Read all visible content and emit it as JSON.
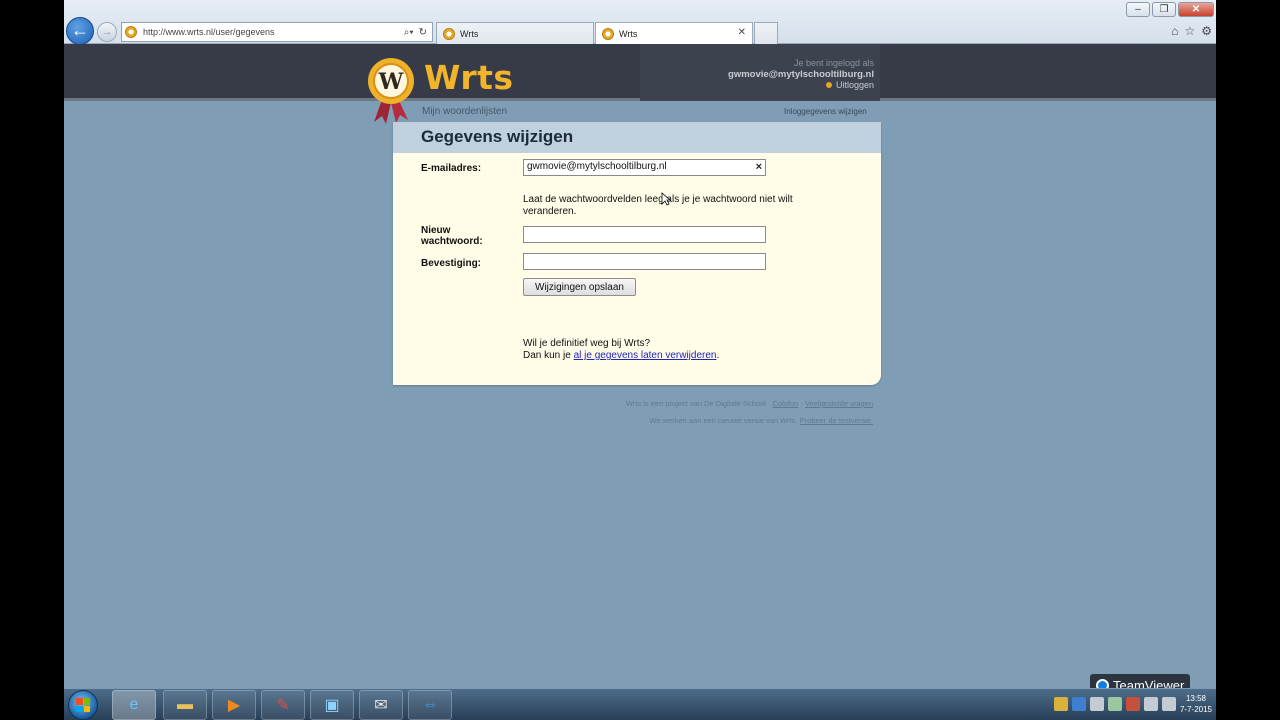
{
  "browser": {
    "url": "http://www.wrts.nl/user/gegevens",
    "tabs": [
      {
        "label": "Wrts",
        "active": false
      },
      {
        "label": "Wrts",
        "active": true
      }
    ],
    "close_label": "✕",
    "tools": [
      "home-icon",
      "star-icon",
      "gear-icon"
    ]
  },
  "site": {
    "logo_text": "Wrts",
    "logged_in_as": "Je bent ingelogd als",
    "user_email": "gwmovie@mytylschooltilburg.nl",
    "logout": "Uitloggen",
    "nav_left": "Mijn woordenlijsten",
    "nav_right": "Inloggegevens wijzigen"
  },
  "form": {
    "title": "Gegevens wijzigen",
    "email_label": "E-mailadres:",
    "email_value": "gwmovie@mytylschooltilburg.nl",
    "note": "Laat de wachtwoordvelden leeg als je je wachtwoord niet wilt veranderen.",
    "new_password_label": "Nieuw wachtwoord:",
    "confirm_label": "Bevestiging:",
    "save_button": "Wijzigingen opslaan",
    "leave_question": "Wil je definitief weg bij Wrts?",
    "leave_prefix": "Dan kun je ",
    "leave_link": "al je gegevens laten verwijderen",
    "leave_suffix": "."
  },
  "footer": {
    "line1_prefix": "Wrts is een project van De Digitale School · ",
    "colofon": "Colofon",
    "sep": " · ",
    "faq": "Veelgestelde vragen",
    "line2_prefix": "We werken aan een nieuwe versie van Wrts. ",
    "try_link": "Probeer de testversie."
  },
  "taskbar": {
    "apps": [
      "ie-icon",
      "folder-icon",
      "media-player-icon",
      "paint-icon",
      "desktop-icon",
      "mail-icon",
      "teamviewer-icon"
    ],
    "time": "13:58",
    "date": "7-7-2015",
    "teamviewer_label": "TeamViewer"
  }
}
